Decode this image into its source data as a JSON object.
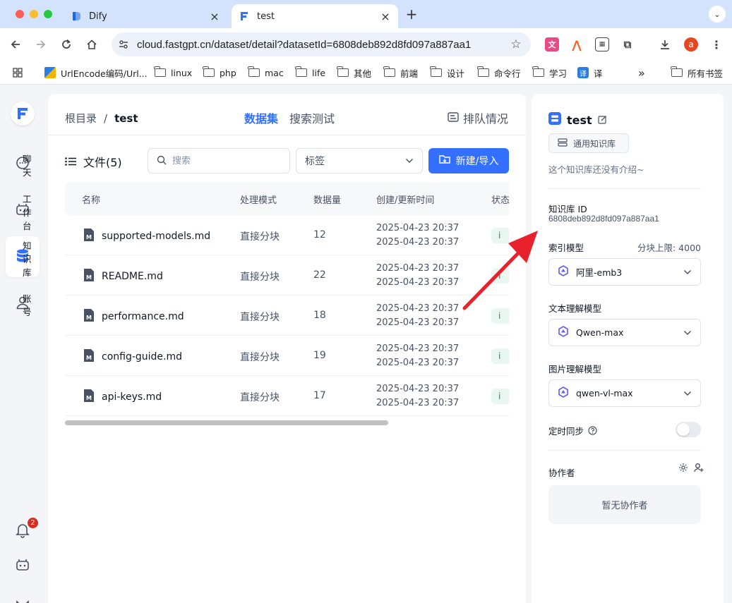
{
  "browser": {
    "tabs": [
      {
        "title": "Dify",
        "active": false
      },
      {
        "title": "test",
        "active": true
      }
    ],
    "url": "cloud.fastgpt.cn/dataset/detail?datasetId=6808deb892d8fd097a887aa1",
    "profile_initial": "a",
    "bookmarks": [
      {
        "label": "UrlEncode编码/Url...",
        "icon": "urlencode-icon"
      },
      {
        "label": "linux",
        "icon": "folder-icon"
      },
      {
        "label": "php",
        "icon": "folder-icon"
      },
      {
        "label": "mac",
        "icon": "folder-icon"
      },
      {
        "label": "life",
        "icon": "folder-icon"
      },
      {
        "label": "其他",
        "icon": "folder-icon"
      },
      {
        "label": "前端",
        "icon": "folder-icon"
      },
      {
        "label": "设计",
        "icon": "folder-icon"
      },
      {
        "label": "命令行",
        "icon": "folder-icon"
      },
      {
        "label": "学习",
        "icon": "folder-icon"
      },
      {
        "label": "译",
        "icon": "translate-icon"
      }
    ],
    "all_bookmarks": "所有书签",
    "more": "»"
  },
  "nav": {
    "items": [
      {
        "label": "聊天",
        "icon": "chat-icon",
        "active": false
      },
      {
        "label": "工作台",
        "icon": "robot-icon",
        "active": false
      },
      {
        "label": "知识库",
        "icon": "database-icon",
        "active": true
      },
      {
        "label": "账号",
        "icon": "user-icon",
        "active": false
      }
    ],
    "notification_count": "2"
  },
  "main": {
    "breadcrumb": {
      "root": "根目录",
      "separator": "/",
      "current": "test"
    },
    "tabs": [
      {
        "label": "数据集",
        "active": true
      },
      {
        "label": "搜索测试",
        "active": false
      }
    ],
    "queue_label": "排队情况",
    "files_label": "文件(5)",
    "search_placeholder": "搜索",
    "tag_placeholder": "标签",
    "new_button": "新建/导入",
    "columns": [
      "名称",
      "处理模式",
      "数据量",
      "创建/更新时间",
      "状态"
    ],
    "rows": [
      {
        "name": "supported-models.md",
        "mode": "直接分块",
        "count": "12",
        "created": "2025-04-23 20:37",
        "updated": "2025-04-23 20:37",
        "status": "i"
      },
      {
        "name": "README.md",
        "mode": "直接分块",
        "count": "22",
        "created": "2025-04-23 20:37",
        "updated": "2025-04-23 20:37",
        "status": "i"
      },
      {
        "name": "performance.md",
        "mode": "直接分块",
        "count": "18",
        "created": "2025-04-23 20:37",
        "updated": "2025-04-23 20:37",
        "status": "i"
      },
      {
        "name": "config-guide.md",
        "mode": "直接分块",
        "count": "19",
        "created": "2025-04-23 20:37",
        "updated": "2025-04-23 20:37",
        "status": "i"
      },
      {
        "name": "api-keys.md",
        "mode": "直接分块",
        "count": "17",
        "created": "2025-04-23 20:37",
        "updated": "2025-04-23 20:37",
        "status": "i"
      }
    ]
  },
  "side": {
    "title": "test",
    "type": "通用知识库",
    "intro": "这个知识库还没有介绍~",
    "id_label": "知识库 ID",
    "id_value": "6808deb892d8fd097a887aa1",
    "index_model_label": "索引模型",
    "chunk_limit": "分块上限: 4000",
    "index_model": "阿里-emb3",
    "text_model_label": "文本理解模型",
    "text_model": "Qwen-max",
    "image_model_label": "图片理解模型",
    "image_model": "qwen-vl-max",
    "sync_label": "定时同步",
    "collab_label": "协作者",
    "no_collab": "暂无协作者"
  },
  "colors": {
    "accent": "#3370ff",
    "annotation_arrow": "#e8212c",
    "status_green": "#039855"
  }
}
